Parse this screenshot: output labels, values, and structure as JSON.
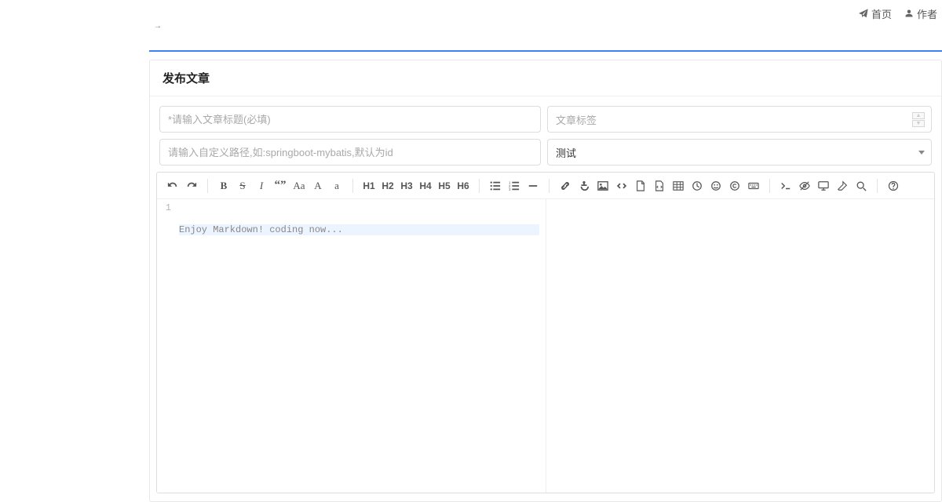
{
  "nav": {
    "home_label": "首页",
    "author_label": "作者"
  },
  "page": {
    "title": "发布文章"
  },
  "form": {
    "title_placeholder": "*请输入文章标题(必填)",
    "tags_placeholder": "文章标签",
    "path_placeholder": "请输入自定义路径,如:springboot-mybatis,默认为id",
    "category_selected": "测试"
  },
  "editor": {
    "placeholder_line": "Enjoy Markdown! coding now...",
    "line_number": "1",
    "headings": [
      "H1",
      "H2",
      "H3",
      "H4",
      "H5",
      "H6"
    ],
    "bold_glyph": "B",
    "strike_glyph": "S",
    "italic_glyph": "I",
    "quote_glyph": "“”",
    "aa_glyph": "Aa",
    "capA_glyph": "A",
    "lowA_glyph": "a"
  }
}
